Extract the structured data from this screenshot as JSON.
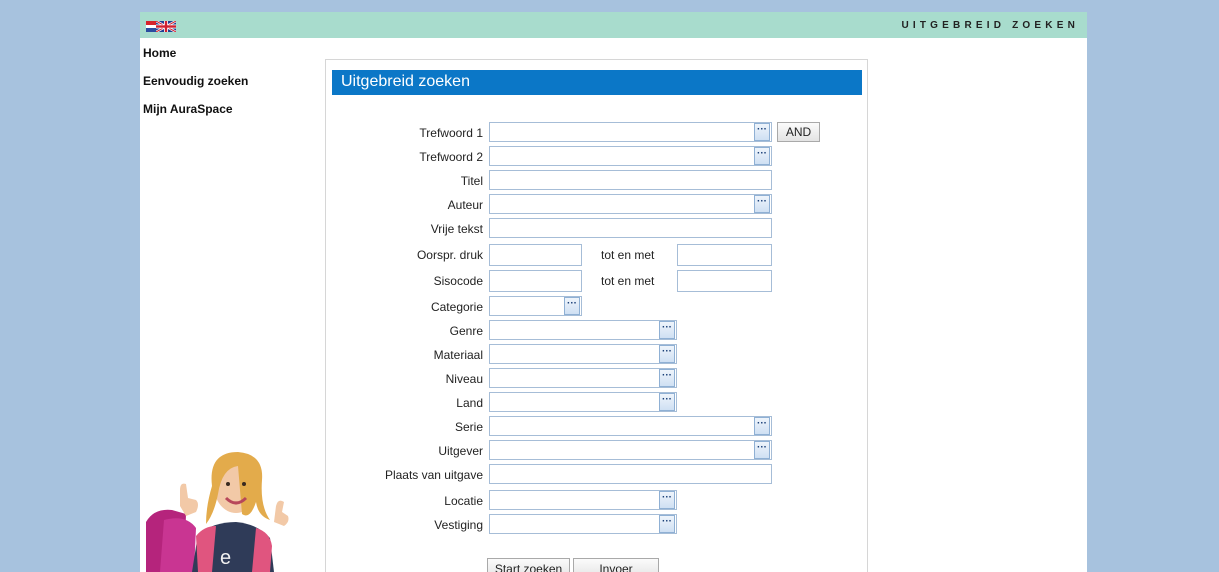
{
  "header": {
    "title": "UITGEBREID ZOEKEN",
    "languages": [
      "nl-flag-icon",
      "uk-flag-icon"
    ]
  },
  "nav": {
    "items": [
      "Home",
      "Eenvoudig zoeken",
      "Mijn AuraSpace"
    ]
  },
  "form": {
    "title": "Uitgebreid zoeken",
    "fields": {
      "trefwoord1": "Trefwoord 1",
      "trefwoord2": "Trefwoord 2",
      "titel": "Titel",
      "auteur": "Auteur",
      "vrije_tekst": "Vrije tekst",
      "oorspr_druk": "Oorspr. druk",
      "sisocode": "Sisocode",
      "tot_en_met": "tot en met",
      "categorie": "Categorie",
      "genre": "Genre",
      "materiaal": "Materiaal",
      "niveau": "Niveau",
      "land": "Land",
      "serie": "Serie",
      "uitgever": "Uitgever",
      "plaats": "Plaats van uitgave",
      "locatie": "Locatie",
      "vestiging": "Vestiging"
    },
    "lookup_symbol": "···",
    "and_label": "AND",
    "search_label": "Start zoeken",
    "clear_label": "Invoer wissen"
  },
  "colors": {
    "background": "#a7c2de",
    "topbar": "#a8dccd",
    "header": "#0b77c7"
  }
}
